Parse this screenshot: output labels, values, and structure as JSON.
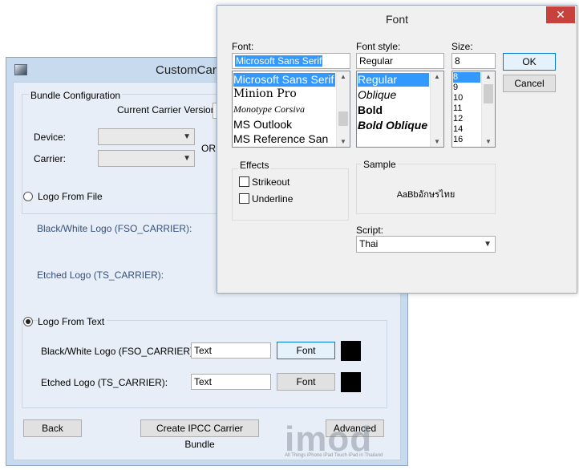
{
  "main": {
    "title": "CustomCarr",
    "bundle_group": "Bundle Configuration",
    "current_version_label": "Current Carrier Version:",
    "device_label": "Device:",
    "carrier_label": "Carrier:",
    "or_label": "OR",
    "logo_from_file": "Logo From File",
    "bw_logo_file_label": "Black/White Logo  (FSO_CARRIER):",
    "etched_logo_file_label": "Etched Logo (TS_CARRIER):",
    "logo_from_text": "Logo From Text",
    "bw_logo_text_label": "Black/White Logo  (FSO_CARRIER):",
    "bw_logo_text_value": "Text",
    "etched_logo_text_label": "Etched Logo (TS_CARRIER):",
    "etched_logo_text_value": "Text",
    "font_button": "Font",
    "back_button": "Back",
    "create_button": "Create IPCC Carrier Bundle",
    "advanced_button": "Advanced",
    "logo_text_selected": true
  },
  "font_dialog": {
    "title": "Font",
    "close_glyph": "✕",
    "font_label": "Font:",
    "font_value": "Microsoft Sans Serif",
    "fonts": [
      "Microsoft Sans Serif",
      "Minion Pro",
      "Monotype Corsiva",
      "MS Outlook",
      "MS Reference San"
    ],
    "style_label": "Font style:",
    "style_value": "Regular",
    "styles": [
      "Regular",
      "Oblique",
      "Bold",
      "Bold Oblique"
    ],
    "size_label": "Size:",
    "size_value": "8",
    "sizes": [
      "8",
      "9",
      "10",
      "11",
      "12",
      "14",
      "16"
    ],
    "ok_button": "OK",
    "cancel_button": "Cancel",
    "effects_label": "Effects",
    "strikeout_label": "Strikeout",
    "underline_label": "Underline",
    "sample_label": "Sample",
    "sample_text": "AaBbอักษรไทย",
    "script_label": "Script:",
    "script_value": "Thai"
  },
  "watermark": "imod",
  "watermark_tagline": "All Things iPhone iPad Touch iPad in Thailand"
}
